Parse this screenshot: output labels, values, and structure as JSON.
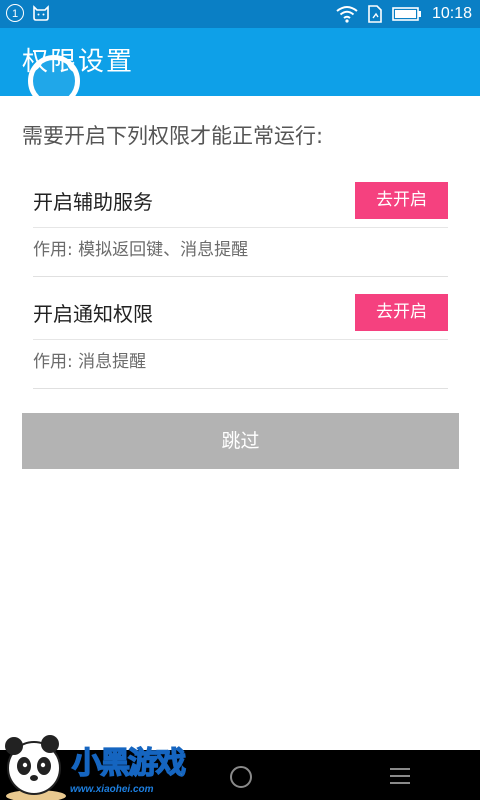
{
  "status_bar": {
    "notification_count": "1",
    "time": "10:18",
    "icons": [
      "notification-badge-icon",
      "cat-icon",
      "wifi-icon",
      "sim-icon",
      "battery-icon"
    ]
  },
  "app_bar": {
    "title": "权限设置",
    "color": "#0ea0e8"
  },
  "main": {
    "intro": "需要开启下列权限才能正常运行:",
    "permissions": [
      {
        "title": "开启辅助服务",
        "button_label": "去开启",
        "description": "作用: 模拟返回键、消息提醒"
      },
      {
        "title": "开启通知权限",
        "button_label": "去开启",
        "description": "作用: 消息提醒"
      }
    ],
    "skip_label": "跳过",
    "accent_color": "#f5417f"
  },
  "watermark": {
    "name": "小黑游戏",
    "url": "www.xiaohei.com"
  }
}
